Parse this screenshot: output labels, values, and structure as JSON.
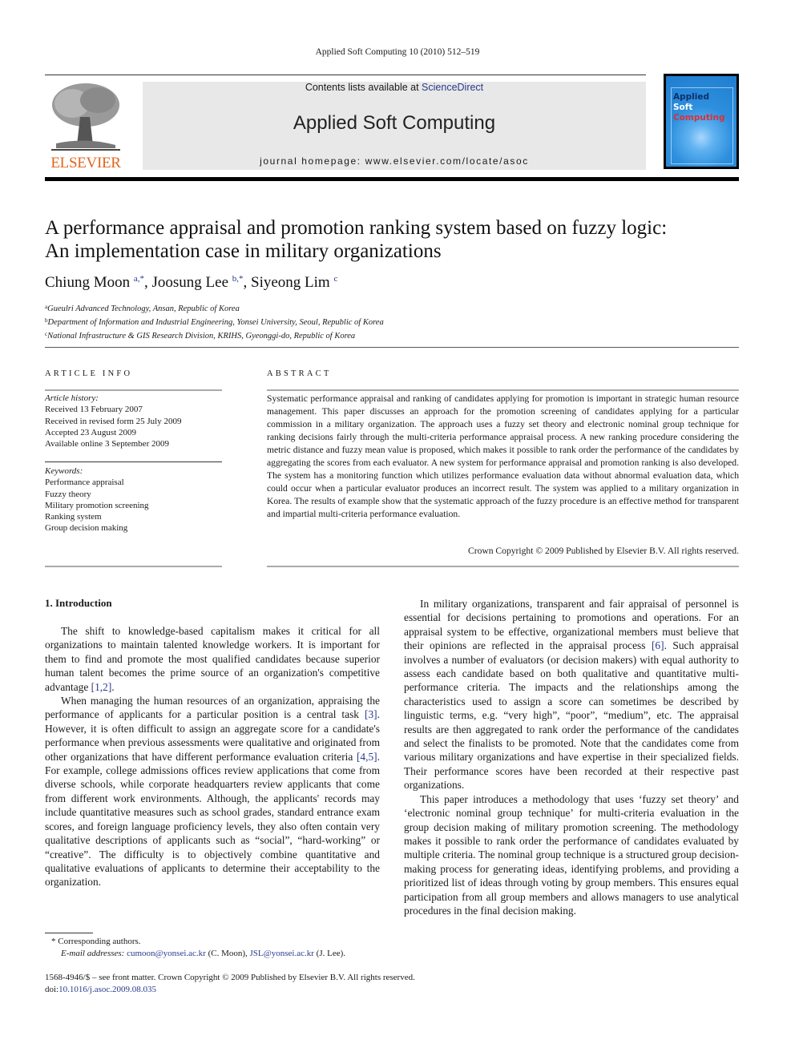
{
  "running_head": "Applied Soft Computing 10 (2010) 512–519",
  "publisher": {
    "logo_word": "ELSEVIER",
    "contents_prefix": "Contents lists available at ",
    "contents_link": "ScienceDirect",
    "journal_title": "Applied Soft Computing",
    "homepage": "journal homepage: www.elsevier.com/locate/asoc",
    "cover_lines": [
      "Applied",
      "Soft",
      "Computing"
    ],
    "brand_color": "#e0661c",
    "link_color": "#2a3a8c"
  },
  "article": {
    "title_line1": "A performance appraisal and promotion ranking system based on fuzzy logic:",
    "title_line2": "An implementation case in military organizations",
    "authors": [
      {
        "name": "Chiung Moon",
        "sup": "a,*"
      },
      {
        "name": "Joosung Lee",
        "sup": "b,*"
      },
      {
        "name": "Siyeong Lim",
        "sup": "c"
      }
    ],
    "affiliations": [
      {
        "key": "a",
        "text": "Gueulri Advanced Technology, Ansan, Republic of Korea"
      },
      {
        "key": "b",
        "text": "Department of Information and Industrial Engineering, Yonsei University, Seoul, Republic of Korea"
      },
      {
        "key": "c",
        "text": "National Infrastructure & GIS Research Division, KRIHS, Gyeonggi-do, Republic of Korea"
      }
    ]
  },
  "article_info": {
    "heading": "ARTICLE INFO",
    "history_label": "Article history:",
    "history": [
      "Received 13 February 2007",
      "Received in revised form 25 July 2009",
      "Accepted 23 August 2009",
      "Available online 3 September 2009"
    ],
    "keywords_label": "Keywords:",
    "keywords": [
      "Performance appraisal",
      "Fuzzy theory",
      "Military promotion screening",
      "Ranking system",
      "Group decision making"
    ]
  },
  "abstract": {
    "heading": "ABSTRACT",
    "text": "Systematic performance appraisal and ranking of candidates applying for promotion is important in strategic human resource management. This paper discusses an approach for the promotion screening of candidates applying for a particular commission in a military organization. The approach uses a fuzzy set theory and electronic nominal group technique for ranking decisions fairly through the multi-criteria performance appraisal process. A new ranking procedure considering the metric distance and fuzzy mean value is proposed, which makes it possible to rank order the performance of the candidates by aggregating the scores from each evaluator. A new system for performance appraisal and promotion ranking is also developed. The system has a monitoring function which utilizes performance evaluation data without abnormal evaluation data, which could occur when a particular evaluator produces an incorrect result. The system was applied to a military organization in Korea. The results of example show that the systematic approach of the fuzzy procedure is an effective method for transparent and impartial multi-criteria performance evaluation.",
    "copyright": "Crown Copyright © 2009 Published by Elsevier B.V. All rights reserved."
  },
  "body": {
    "section_heading": "1.  Introduction",
    "p1_a": "The shift to knowledge-based capitalism makes it critical for all organizations to maintain talented knowledge workers. It is important for them to find and promote the most qualified candidates because superior human talent becomes the prime source of an organization's competitive advantage ",
    "p1_ref": "[1,2]",
    "p1_b": ".",
    "p2_a": "When managing the human resources of an organization, appraising the performance of applicants for a particular position is a central task ",
    "p2_ref1": "[3]",
    "p2_b": ". However, it is often difficult to assign an aggregate score for a candidate's performance when previous assessments were qualitative and originated from other organizations that have different performance evaluation criteria ",
    "p2_ref2": "[4,5]",
    "p2_c": ". For example, college admissions offices review applications that come from diverse schools, while corporate headquarters review applicants that come from different work environments. Although, the applicants' records may include quantitative measures such as school grades, standard entrance exam scores, and foreign language proficiency levels, they also often contain very qualitative descriptions of applicants such as “social”, “hard-working” or “creative”. The difficulty is to objectively combine quantitative and qualitative evaluations of applicants to determine their acceptability to the organization.",
    "p3_a": "In military organizations, transparent and fair appraisal of personnel is essential for decisions pertaining to promotions and operations. For an appraisal system to be effective, organizational members must believe that their opinions are reflected in the appraisal process ",
    "p3_ref": "[6]",
    "p3_b": ". Such appraisal involves a number of evaluators (or decision makers) with equal authority to assess each candidate based on both qualitative and quantitative multi-performance criteria. The impacts and the relationships among the characteristics used to assign a score can sometimes be described by linguistic terms, e.g. “very high”, “poor”, “medium”, etc. The appraisal results are then aggregated to rank order the performance of the candidates and select the finalists to be promoted. Note that the candidates come from various military organizations and have expertise in their specialized fields. Their performance scores have been recorded at their respective past organizations.",
    "p4": "This paper introduces a methodology that uses ‘fuzzy set theory’ and ‘electronic nominal group technique’ for multi-criteria evaluation in the group decision making of military promotion screening. The methodology makes it possible to rank order the performance of candidates evaluated by multiple criteria. The nominal group technique is a structured group decision-making process for generating ideas, identifying problems, and providing a prioritized list of ideas through voting by group members. This ensures equal participation from all group members and allows managers to use analytical procedures in the final decision making."
  },
  "footnote": {
    "star_text": "*  Corresponding authors.",
    "email_label": "E-mail addresses: ",
    "email1": "cumoon@yonsei.ac.kr",
    "email1_who": " (C. Moon), ",
    "email2": "JSL@yonsei.ac.kr",
    "email2_who": " (J. Lee)."
  },
  "footer": {
    "issn_line": "1568-4946/$ – see front matter. Crown Copyright © 2009 Published by Elsevier B.V. All rights reserved.",
    "doi_prefix": "doi:",
    "doi": "10.1016/j.asoc.2009.08.035"
  }
}
